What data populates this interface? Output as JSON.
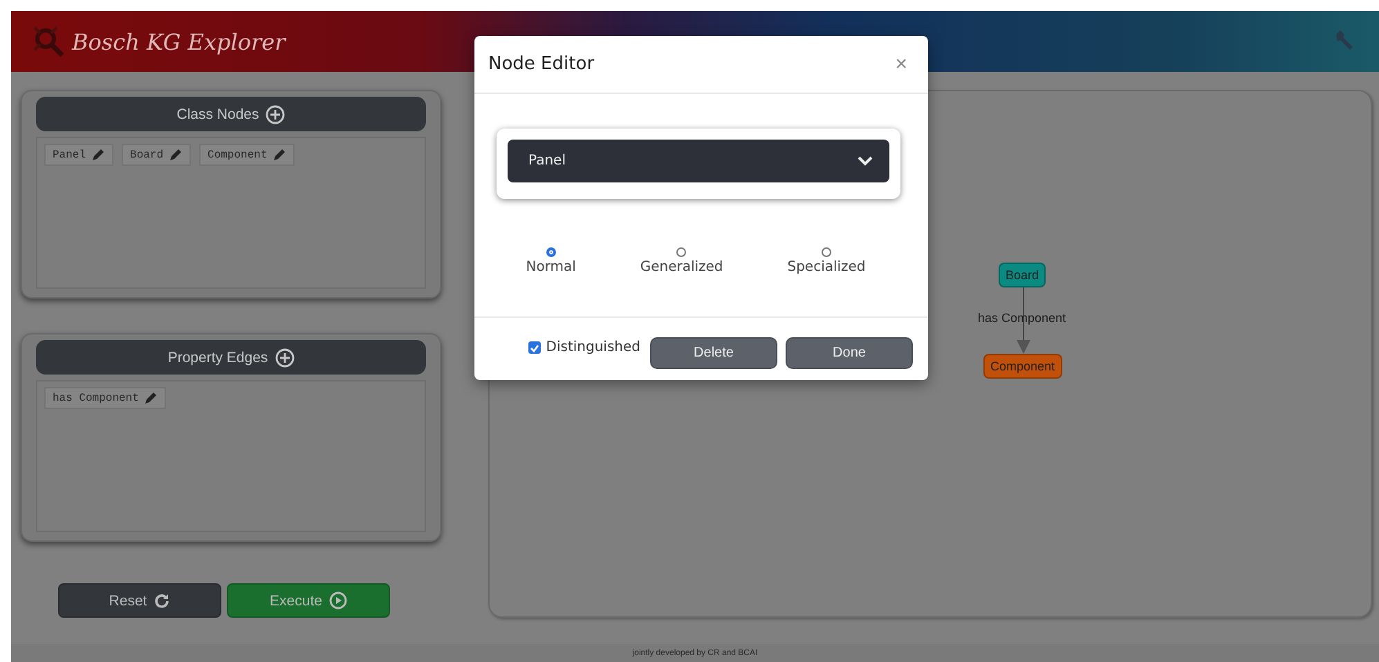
{
  "header": {
    "title": "Bosch KG Explorer"
  },
  "class_nodes": {
    "title": "Class Nodes",
    "items": [
      "Panel",
      "Board",
      "Component"
    ]
  },
  "property_edges": {
    "title": "Property Edges",
    "items": [
      "has Component"
    ]
  },
  "actions": [
    {
      "kind": "reset",
      "label": "Reset"
    },
    {
      "kind": "execute",
      "label": "Execute"
    }
  ],
  "graph": {
    "nodes": [
      {
        "label": "Board",
        "color": "#0a8a80"
      },
      {
        "label": "Component",
        "color": "#c0500a"
      }
    ],
    "edges": [
      {
        "label": "has Component"
      }
    ]
  },
  "modal": {
    "title": "Node Editor",
    "close": "×",
    "select_value": "Panel",
    "options": [
      {
        "label": "Normal",
        "selected": true
      },
      {
        "label": "Generalized",
        "selected": false
      },
      {
        "label": "Specialized",
        "selected": false
      }
    ],
    "distinguished": {
      "label": "Distinguished",
      "checked": true
    },
    "buttons": [
      "Delete",
      "Done"
    ]
  },
  "footer": "jointly developed by CR and BCAI"
}
